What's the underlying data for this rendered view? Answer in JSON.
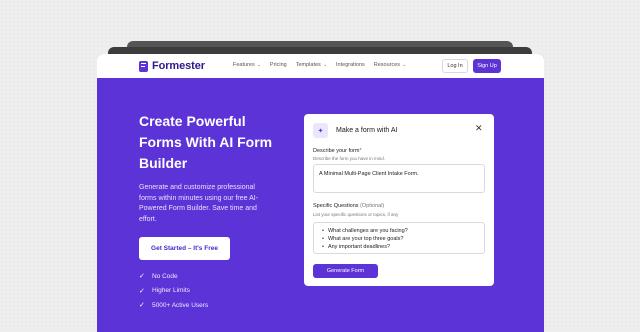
{
  "nav": {
    "brand": "Formester",
    "menu": [
      {
        "label": "Features",
        "has_dropdown": true
      },
      {
        "label": "Pricing",
        "has_dropdown": false
      },
      {
        "label": "Templates",
        "has_dropdown": true
      },
      {
        "label": "Integrations",
        "has_dropdown": false
      },
      {
        "label": "Resources",
        "has_dropdown": true
      }
    ],
    "login_label": "Log In",
    "signup_label": "Sign Up"
  },
  "hero": {
    "title": "Create Powerful Forms With AI Form Builder",
    "description": "Generate and customize professional forms within minutes using our free AI-Powered Form Builder. Save time and effort.",
    "cta_label": "Get Started – It's Free",
    "features": [
      "No Code",
      "Higher Limits",
      "5000+ Active Users"
    ]
  },
  "card": {
    "title": "Make a form with AI",
    "close_icon": "close-icon",
    "describe_label": "Describe your form",
    "describe_required": "*",
    "describe_hint": "Describe the form you have in mind.",
    "describe_value": "A Minimal Multi-Page Client Intake Form.",
    "questions_label": "Specific Questions",
    "questions_optional": "(Optional)",
    "questions_hint": "List your specific questions or topics, if any",
    "questions": [
      "What challenges are you facing?",
      "What are your top three goals?",
      "Any important deadlines?"
    ],
    "generate_label": "Generate Form"
  },
  "colors": {
    "brand_purple": "#5b33d6",
    "nav_bg": "#ffffff",
    "card_bg": "#ffffff"
  }
}
